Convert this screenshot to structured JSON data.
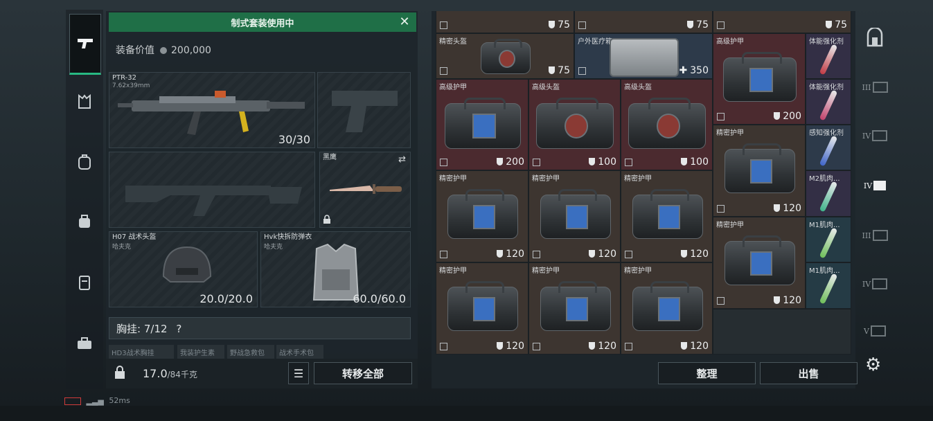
{
  "banner": {
    "title": "制式套装使用中"
  },
  "equipment_value": {
    "label": "装备价值",
    "amount": "200,000"
  },
  "slots": {
    "primary": {
      "name": "PTR-32",
      "caliber": "7.62x39mm",
      "ammo": "30/30"
    },
    "melee": {
      "name": "黑鹰"
    },
    "helmet": {
      "name": "H07 战术头盔",
      "brand": "哈夫克",
      "durability": "20.0/20.0"
    },
    "armor": {
      "name": "Hvk快拆防弹衣",
      "brand": "哈夫克",
      "durability": "60.0/60.0"
    }
  },
  "chest_rig": {
    "label": "胸挂:",
    "count": "7/12",
    "help": "?"
  },
  "chest_items": [
    "HD3战术胸挂",
    "我装护生素",
    "野战急救包",
    "战术手术包"
  ],
  "footer_left": {
    "weight": "17.0",
    "weight_max": "/84千克",
    "transfer_all": "转移全部"
  },
  "footer_right": {
    "sort": "整理",
    "sell": "出售"
  },
  "status": {
    "ping": "52ms"
  },
  "grid_items": [
    {
      "name": "",
      "value": "75"
    },
    {
      "name": "",
      "value": "75"
    },
    {
      "name": "",
      "value": "75"
    },
    {
      "name": "精密头盔",
      "value": "75"
    },
    {
      "name": "户外医疗箱",
      "value": "350"
    },
    {
      "name": "高级护甲",
      "value": "200"
    },
    {
      "name": "体能强化剂",
      "value": ""
    },
    {
      "name": "高级护甲",
      "value": "200"
    },
    {
      "name": "高级头盔",
      "value": "100"
    },
    {
      "name": "高级头盔",
      "value": "100"
    },
    {
      "name": "体能强化剂",
      "value": ""
    },
    {
      "name": "精密护甲",
      "value": "120"
    },
    {
      "name": "感知强化剂",
      "value": ""
    },
    {
      "name": "精密护甲",
      "value": "120"
    },
    {
      "name": "精密护甲",
      "value": "120"
    },
    {
      "name": "精密护甲",
      "value": "120"
    },
    {
      "name": "M2肌肉...",
      "value": ""
    },
    {
      "name": "精密护甲",
      "value": "120"
    },
    {
      "name": "M1肌肉...",
      "value": ""
    },
    {
      "name": "精密护甲",
      "value": "120"
    },
    {
      "name": "精密护甲",
      "value": "120"
    },
    {
      "name": "精密护甲",
      "value": "120"
    },
    {
      "name": "M1肌肉...",
      "value": ""
    }
  ],
  "right_rail": [
    "III",
    "IV",
    "IV",
    "III",
    "IV",
    "V"
  ],
  "colors": {
    "accent_green": "#28b983",
    "banner_green": "#1f6f47",
    "rare_red": "#4b2a2f",
    "common_brown": "#3d3530"
  }
}
